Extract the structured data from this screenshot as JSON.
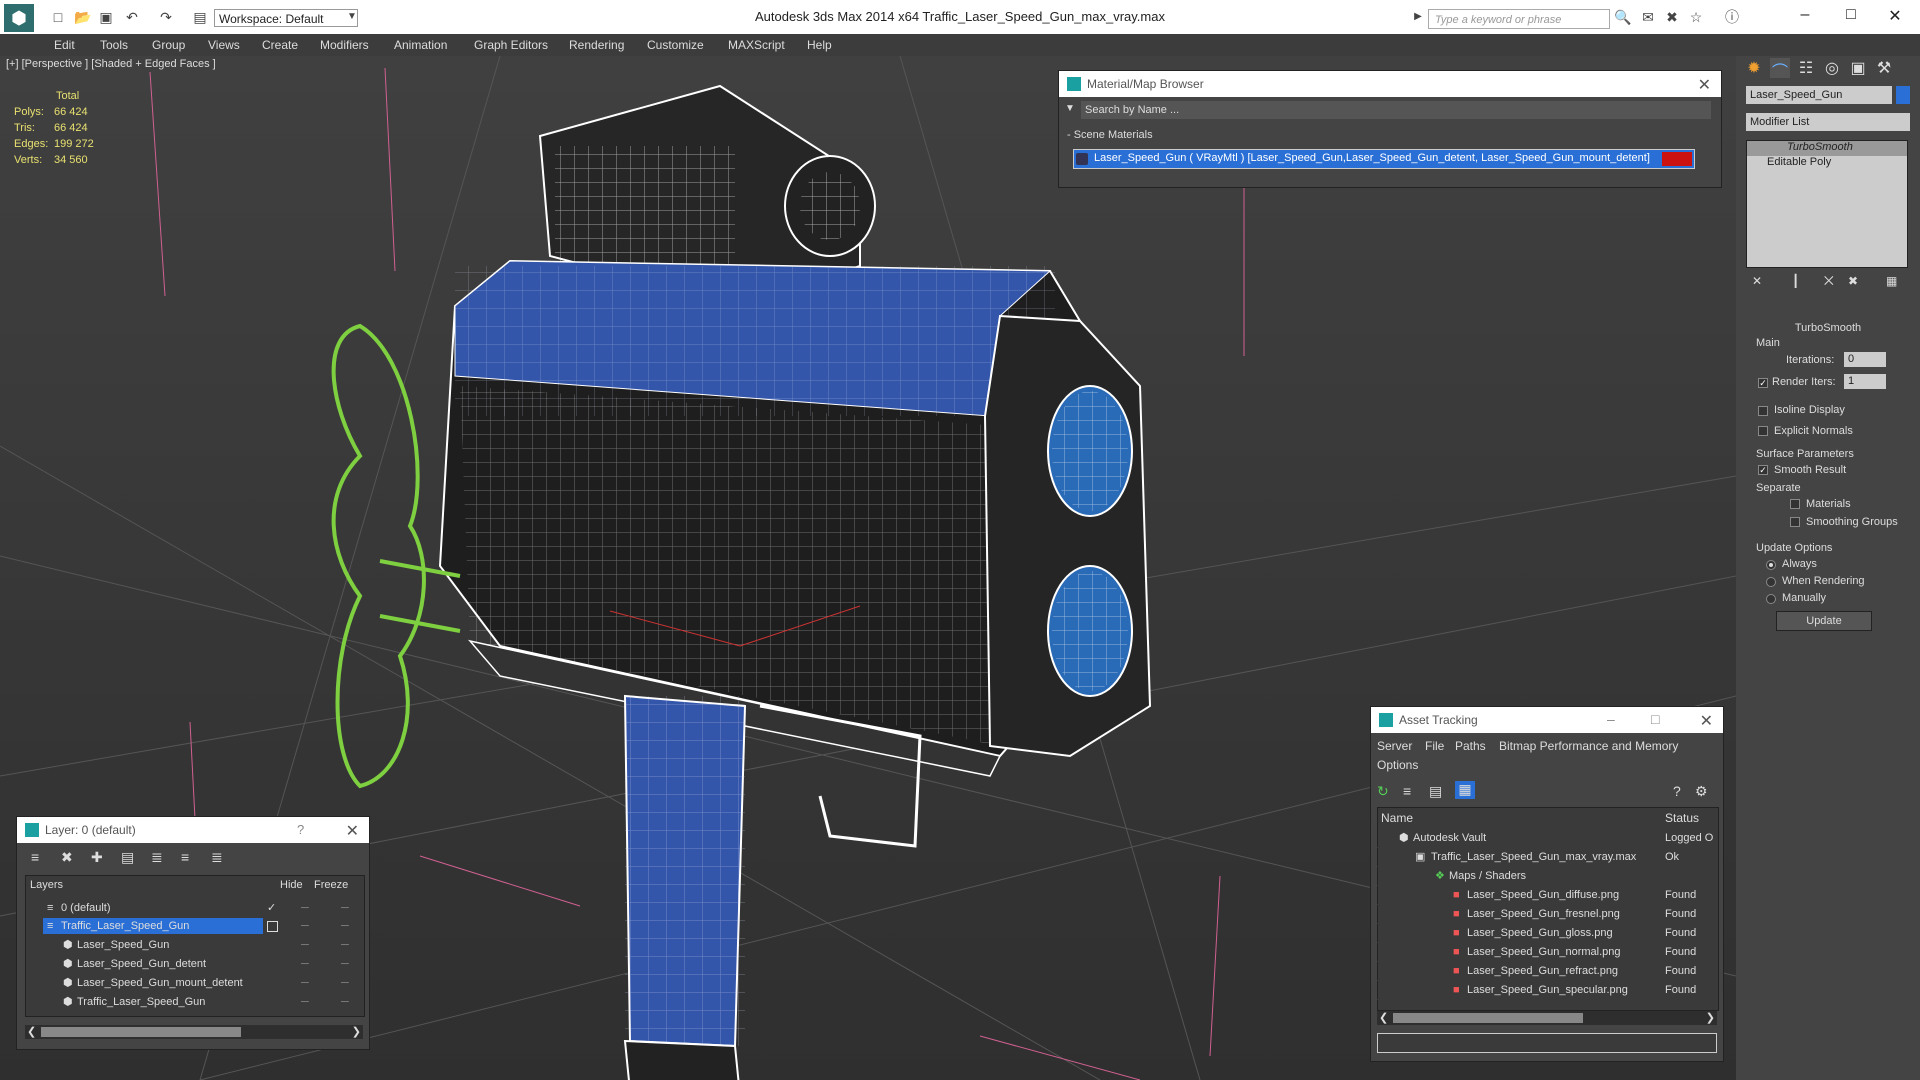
{
  "titlebar": {
    "title": "Autodesk 3ds Max  2014 x64      Traffic_Laser_Speed_Gun_max_vray.max",
    "workspace": "Workspace: Default",
    "search_placeholder": "Type a keyword or phrase"
  },
  "menu": [
    "Edit",
    "Tools",
    "Group",
    "Views",
    "Create",
    "Modifiers",
    "Animation",
    "Graph Editors",
    "Rendering",
    "Customize",
    "MAXScript",
    "Help"
  ],
  "viewport": {
    "label": "[+] [Perspective ] [Shaded + Edged Faces ]",
    "stats": {
      "header": "Total",
      "rows": [
        {
          "k": "Polys:",
          "v": "66 424"
        },
        {
          "k": "Tris:",
          "v": "66 424"
        },
        {
          "k": "Edges:",
          "v": "199 272"
        },
        {
          "k": "Verts:",
          "v": "34 560"
        }
      ]
    }
  },
  "command_panel": {
    "object_name": "Laser_Speed_Gun",
    "modifier_list": "Modifier List",
    "stack": [
      "TurboSmooth",
      "Editable Poly"
    ],
    "turbosmooth": {
      "title": "TurboSmooth",
      "main": "Main",
      "iterations_label": "Iterations:",
      "iterations": "0",
      "render_iters_label": "Render Iters:",
      "render_iters": "1",
      "isoline": "Isoline Display",
      "explicit": "Explicit Normals",
      "surface": "Surface Parameters",
      "smooth_result": "Smooth Result",
      "separate": "Separate",
      "materials": "Materials",
      "smoothing_groups": "Smoothing Groups",
      "update_options": "Update Options",
      "always": "Always",
      "when_rendering": "When Rendering",
      "manually": "Manually",
      "update_button": "Update"
    }
  },
  "material_browser": {
    "title": "Material/Map Browser",
    "search_placeholder": "Search by Name ...",
    "section": "- Scene Materials",
    "item": "Laser_Speed_Gun  ( VRayMtl ) [Laser_Speed_Gun,Laser_Speed_Gun_detent, Laser_Speed_Gun_mount_detent]",
    "item_color": "#cc1111"
  },
  "layer_dialog": {
    "title": "Layer: 0 (default)",
    "help": "?",
    "columns": [
      "Layers",
      "Hide",
      "Freeze"
    ],
    "rows": [
      {
        "name": "0 (default)",
        "indent": 1
      },
      {
        "name": "Traffic_Laser_Speed_Gun",
        "indent": 1,
        "selected": true
      },
      {
        "name": "Laser_Speed_Gun",
        "indent": 2
      },
      {
        "name": "Laser_Speed_Gun_detent",
        "indent": 2
      },
      {
        "name": "Laser_Speed_Gun_mount_detent",
        "indent": 2
      },
      {
        "name": "Traffic_Laser_Speed_Gun",
        "indent": 2
      }
    ]
  },
  "asset_tracking": {
    "title": "Asset Tracking",
    "menu": [
      "Server",
      "File",
      "Paths",
      "Bitmap Performance and Memory"
    ],
    "menu2": "Options",
    "columns": [
      "Name",
      "Status"
    ],
    "rows": [
      {
        "name": "Autodesk Vault",
        "status": "Logged O",
        "indent": 0
      },
      {
        "name": "Traffic_Laser_Speed_Gun_max_vray.max",
        "status": "Ok",
        "indent": 1
      },
      {
        "name": "Maps / Shaders",
        "status": "",
        "indent": 2
      },
      {
        "name": "Laser_Speed_Gun_diffuse.png",
        "status": "Found",
        "indent": 3
      },
      {
        "name": "Laser_Speed_Gun_fresnel.png",
        "status": "Found",
        "indent": 3
      },
      {
        "name": "Laser_Speed_Gun_gloss.png",
        "status": "Found",
        "indent": 3
      },
      {
        "name": "Laser_Speed_Gun_normal.png",
        "status": "Found",
        "indent": 3
      },
      {
        "name": "Laser_Speed_Gun_refract.png",
        "status": "Found",
        "indent": 3
      },
      {
        "name": "Laser_Speed_Gun_specular.png",
        "status": "Found",
        "indent": 3
      }
    ]
  },
  "colors": {
    "accent_blue": "#3355aa",
    "selection": "#2a6fd6",
    "stats_yellow": "#e8e070"
  }
}
